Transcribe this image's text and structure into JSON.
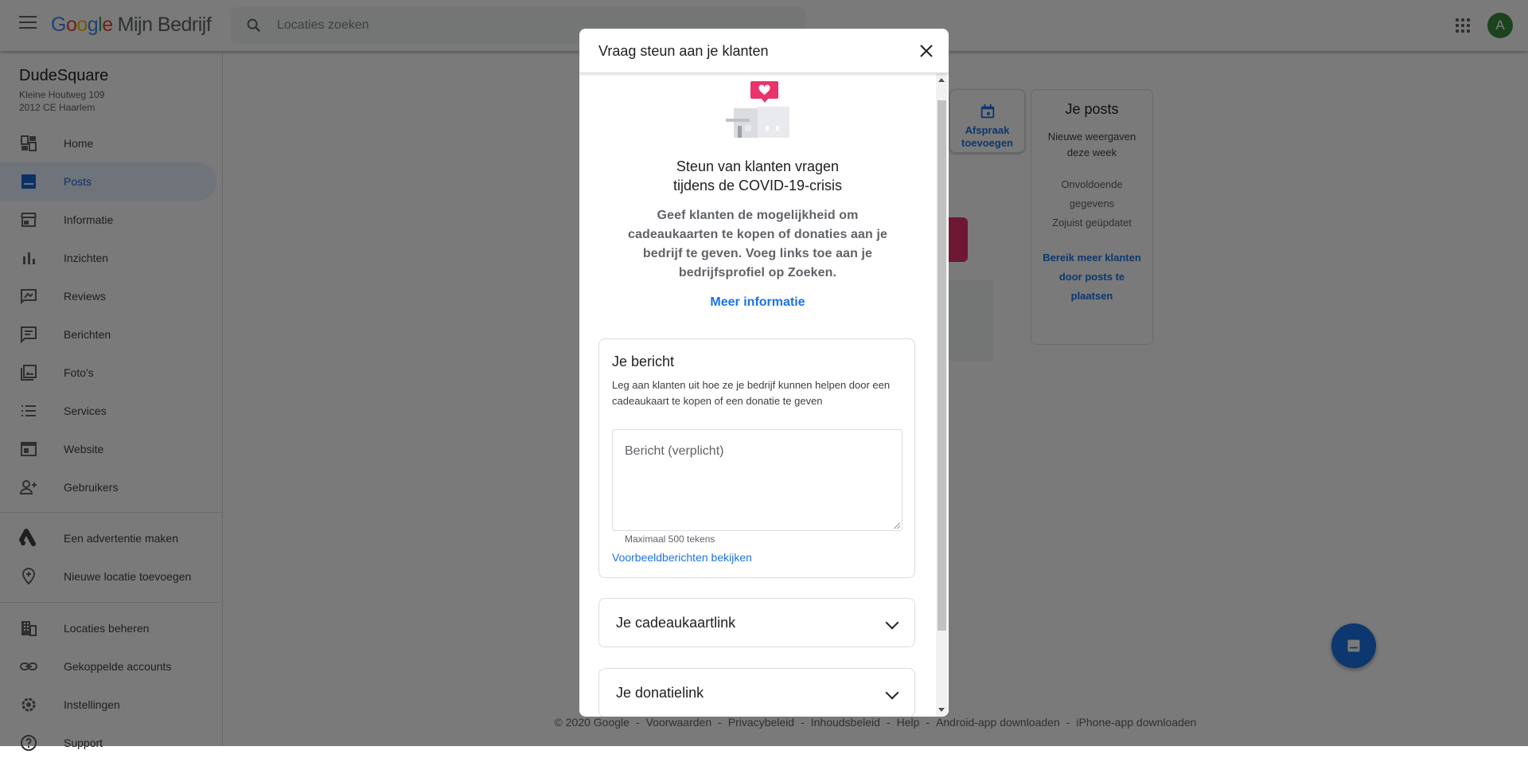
{
  "header": {
    "logo_google": "Google",
    "logo_product": "Mijn Bedrijf",
    "search_placeholder": "Locaties zoeken",
    "avatar_initial": "A"
  },
  "business": {
    "name": "DudeSquare",
    "address_line1": "Kleine Houtweg 109",
    "address_line2": "2012 CE Haarlem"
  },
  "sidebar": {
    "items": [
      {
        "label": "Home",
        "icon": "dashboard-icon",
        "active": false
      },
      {
        "label": "Posts",
        "icon": "posts-icon",
        "active": true
      },
      {
        "label": "Informatie",
        "icon": "storefront-icon",
        "active": false
      },
      {
        "label": "Inzichten",
        "icon": "bar-chart-icon",
        "active": false
      },
      {
        "label": "Reviews",
        "icon": "reviews-icon",
        "active": false
      },
      {
        "label": "Berichten",
        "icon": "chat-icon",
        "active": false
      },
      {
        "label": "Foto's",
        "icon": "photos-icon",
        "active": false
      },
      {
        "label": "Services",
        "icon": "list-icon",
        "active": false
      },
      {
        "label": "Website",
        "icon": "website-icon",
        "active": false
      },
      {
        "label": "Gebruikers",
        "icon": "add-person-icon",
        "active": false
      }
    ],
    "extra": [
      {
        "label": "Een advertentie maken",
        "icon": "google-ads-icon"
      },
      {
        "label": "Nieuwe locatie toevoegen",
        "icon": "add-location-icon"
      }
    ],
    "manage": [
      {
        "label": "Locaties beheren",
        "icon": "buildings-icon"
      },
      {
        "label": "Gekoppelde accounts",
        "icon": "link-icon"
      },
      {
        "label": "Instellingen",
        "icon": "settings-icon"
      },
      {
        "label": "Support",
        "icon": "help-icon"
      }
    ]
  },
  "background": {
    "appointment_label": "Afspraak toevoegen",
    "posts_card": {
      "title": "Je posts",
      "metric": "Nieuwe weergaven deze week",
      "value": "Onvoldoende gegevens",
      "updated": "Zojuist geüpdatet",
      "cta": "Bereik meer klanten door posts te plaatsen"
    }
  },
  "footer": {
    "links": [
      "© 2020 Google",
      "Voorwaarden",
      "Privacybeleid",
      "Inhoudsbeleid",
      "Help",
      "Android-app downloaden",
      "iPhone-app downloaden"
    ]
  },
  "modal": {
    "title": "Vraag steun aan je klanten",
    "heading_line1": "Steun van klanten vragen",
    "heading_line2": "tijdens de COVID-19-crisis",
    "description": "Geef klanten de mogelijkheid om cadeaukaarten te kopen of donaties aan je bedrijf te geven. Voeg links toe aan je bedrijfsprofiel op Zoeken.",
    "more_link": "Meer informatie",
    "message_card": {
      "title": "Je bericht",
      "description": "Leg aan klanten uit hoe ze je bedrijf kunnen helpen door een cadeaukaart te kopen of een donatie te geven",
      "placeholder": "Bericht (verplicht)",
      "value": "",
      "helper": "Maximaal 500 tekens",
      "examples_link": "Voorbeeldberichten bekijken"
    },
    "giftcard_section": "Je cadeaukaartlink",
    "donation_section": "Je donatielink"
  },
  "colors": {
    "accent": "#1a73e8",
    "heart": "#e8336b",
    "avatar": "#3c8a3e"
  }
}
